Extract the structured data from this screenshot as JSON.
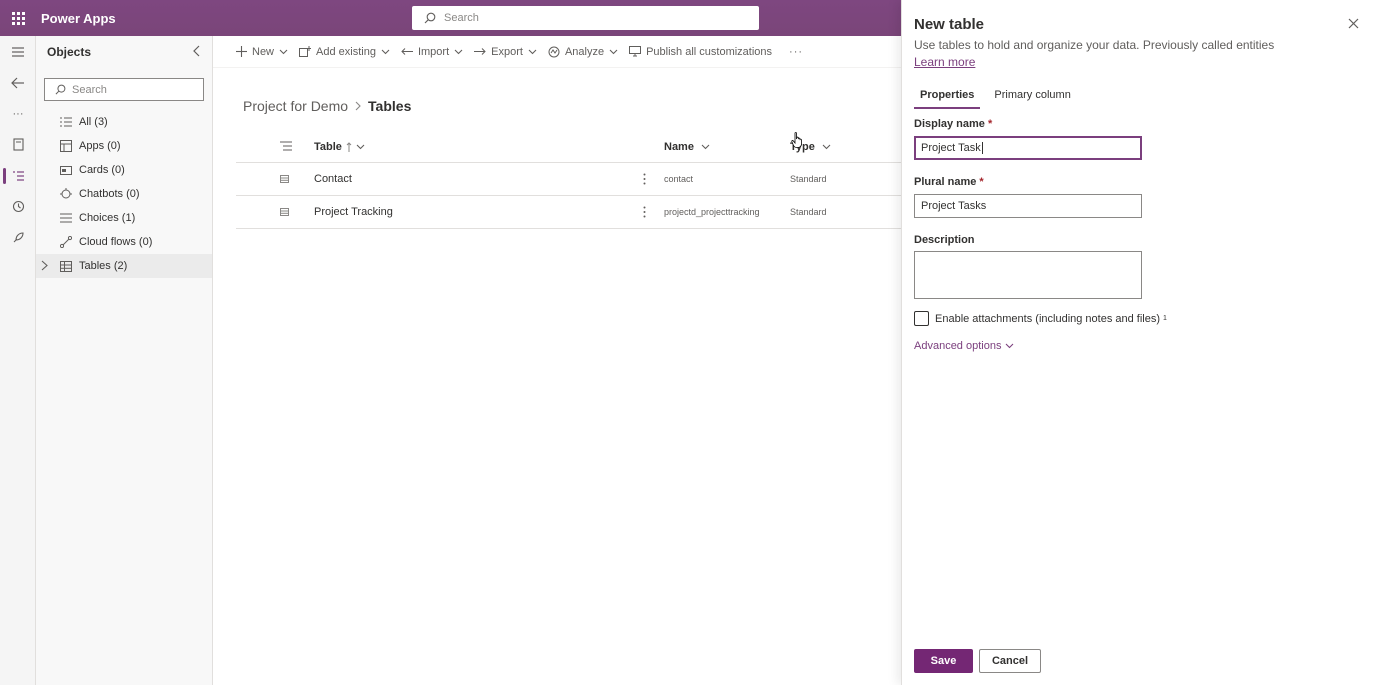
{
  "app": {
    "title": "Power Apps"
  },
  "top_search": {
    "placeholder": "Search"
  },
  "objects": {
    "title": "Objects",
    "search_placeholder": "Search",
    "items": [
      {
        "label": "All  (3)",
        "icon": "list-icon"
      },
      {
        "label": "Apps  (0)",
        "icon": "apps-icon"
      },
      {
        "label": "Cards  (0)",
        "icon": "card-icon"
      },
      {
        "label": "Chatbots  (0)",
        "icon": "chatbot-icon"
      },
      {
        "label": "Choices  (1)",
        "icon": "choices-icon"
      },
      {
        "label": "Cloud flows  (0)",
        "icon": "flow-icon"
      },
      {
        "label": "Tables  (2)",
        "icon": "table-icon"
      }
    ]
  },
  "commands": {
    "new": "New",
    "add_existing": "Add existing",
    "import": "Import",
    "export": "Export",
    "analyze": "Analyze",
    "publish": "Publish all customizations",
    "more": "···"
  },
  "breadcrumb": {
    "parent": "Project for Demo",
    "current": "Tables"
  },
  "grid": {
    "headers": {
      "table": "Table",
      "name": "Name",
      "type": "Type"
    },
    "rows": [
      {
        "table": "Contact",
        "name": "contact",
        "type": "Standard"
      },
      {
        "table": "Project Tracking",
        "name": "projectd_projecttracking",
        "type": "Standard"
      }
    ]
  },
  "panel": {
    "title": "New table",
    "description": "Use tables to hold and organize your data. Previously called entities",
    "learn_more": "Learn more",
    "tabs": [
      "Properties",
      "Primary column"
    ],
    "display_name_label": "Display name",
    "display_name_value": "Project Task",
    "plural_name_label": "Plural name",
    "plural_name_value": "Project Tasks",
    "description_label": "Description",
    "required_mark": "*",
    "attachments_label": "Enable attachments (including notes and files)",
    "attachments_footnote": "1",
    "advanced_options": "Advanced options",
    "save": "Save",
    "cancel": "Cancel"
  },
  "colors": {
    "accent": "#742774",
    "topbar": "#7b3f7e"
  }
}
